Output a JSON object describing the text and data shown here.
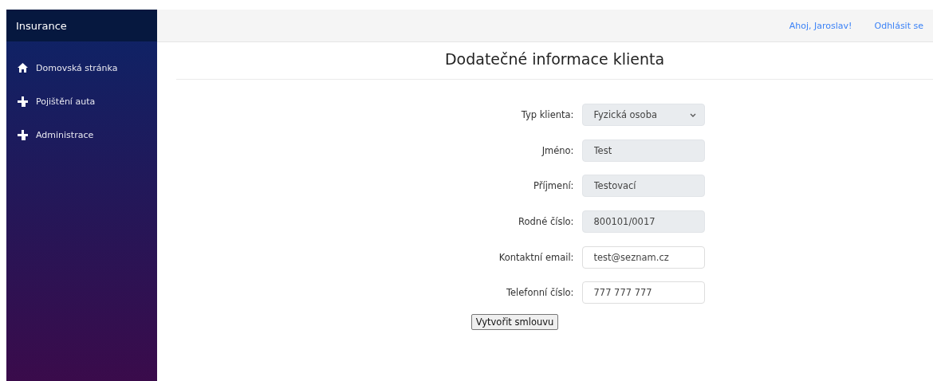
{
  "sidebar": {
    "brand": "Insurance",
    "items": [
      {
        "label": "Domovská stránka",
        "kind": "home"
      },
      {
        "label": "Pojištění auta",
        "kind": "plus"
      },
      {
        "label": "Administrace",
        "kind": "plus"
      }
    ]
  },
  "top_bar": {
    "greeting": "Ahoj, Jaroslav!",
    "logout": "Odhlásit se"
  },
  "title": "Dodatečné informace klienta",
  "form": {
    "fields": [
      {
        "label": "Typ klienta:",
        "kind": "select",
        "value": "Fyzická osoba",
        "disabled": true
      },
      {
        "label": "Jméno:",
        "kind": "input",
        "value": "Test",
        "disabled": true
      },
      {
        "label": "Příjmení:",
        "kind": "input",
        "value": "Testovací",
        "disabled": true
      },
      {
        "label": "Rodné číslo:",
        "kind": "input",
        "value": "800101/0017",
        "disabled": true
      },
      {
        "label": "Kontaktní email:",
        "kind": "input",
        "value": "test@seznam.cz",
        "disabled": false
      },
      {
        "label": "Telefonní číslo:",
        "kind": "input",
        "value": "777 777 777",
        "disabled": false
      }
    ],
    "submit": "Vytvořit smlouvu"
  }
}
